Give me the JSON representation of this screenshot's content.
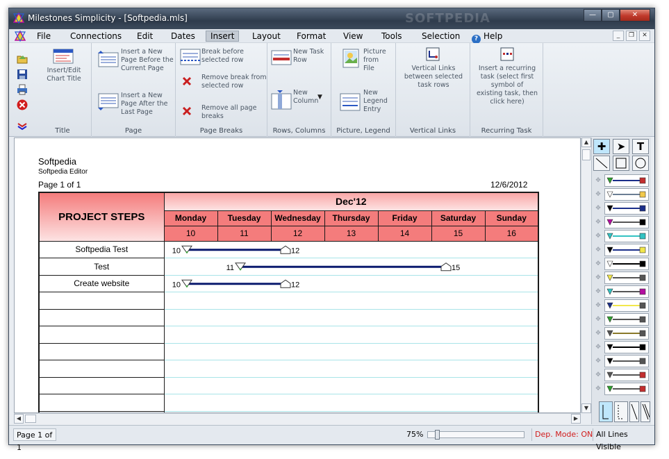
{
  "window": {
    "title": "Milestones Simplicity - [Softpedia.mls]",
    "watermark": "SOFTPEDIA"
  },
  "menu": {
    "items": [
      "File",
      "Connections",
      "Edit",
      "Dates",
      "Insert",
      "Layout",
      "Format",
      "View",
      "Tools",
      "Selection",
      "Help"
    ],
    "active": "Insert"
  },
  "ribbon": {
    "groups": {
      "title": {
        "label": "Title",
        "insert_edit_title_line1": "Insert/Edit",
        "insert_edit_title_line2": "Chart Title"
      },
      "page": {
        "label": "Page",
        "insert_before_line1": "Insert a New",
        "insert_before_line2": "Page Before the",
        "insert_before_line3": "Current Page",
        "insert_after_line1": "Insert a New",
        "insert_after_line2": "Page After the",
        "insert_after_line3": "Last Page"
      },
      "page_breaks": {
        "label": "Page Breaks",
        "break_before_line1": "Break before",
        "break_before_line2": "selected row",
        "remove_break_line1": "Remove break from",
        "remove_break_line2": "selected row",
        "remove_all_line1": "Remove all page",
        "remove_all_line2": "breaks"
      },
      "rows_columns": {
        "label": "Rows, Columns",
        "new_task_row_line1": "New Task",
        "new_task_row_line2": "Row",
        "new_column_line1": "New",
        "new_column_line2": "Column"
      },
      "picture_legend": {
        "label": "Picture, Legend",
        "picture_line1": "Picture",
        "picture_line2": "from",
        "picture_line3": "File",
        "legend_line1": "New",
        "legend_line2": "Legend",
        "legend_line3": "Entry"
      },
      "vertical_links": {
        "label": "Vertical Links",
        "text_line1": "Vertical Links",
        "text_line2": "between selected",
        "text_line3": "task rows"
      },
      "recurring_task": {
        "label": "Recurring Task",
        "text_line1": "Insert a recurring",
        "text_line2": "task (select first",
        "text_line3": "symbol of",
        "text_line4": "existing task, then",
        "text_line5": "click here)"
      }
    }
  },
  "document": {
    "title": "Softpedia",
    "subtitle": "Softpedia Editor",
    "page_label": "Page 1 of 1",
    "date": "12/6/2012",
    "steps_header": "PROJECT STEPS",
    "month_label": "Dec'12",
    "days": [
      "Monday",
      "Tuesday",
      "Wednesday",
      "Thursday",
      "Friday",
      "Saturday",
      "Sunday"
    ],
    "dates": [
      "10",
      "11",
      "12",
      "13",
      "14",
      "15",
      "16"
    ],
    "tasks": [
      {
        "name": "Softpedia Test",
        "start": "10",
        "end": "12"
      },
      {
        "name": "Test",
        "start": "11",
        "end": "15"
      },
      {
        "name": "Create website",
        "start": "10",
        "end": "12"
      }
    ],
    "colors": {
      "header_pink": "#f47c7c",
      "header_pale": "#fde3e3",
      "bar_navy": "#0a1a6e",
      "gridline": "#a8e4e8"
    }
  },
  "status": {
    "page": "Page 1 of 1",
    "zoom": "75%",
    "dep_mode": "Dep. Mode: ON",
    "lines": "All Lines Visible"
  }
}
